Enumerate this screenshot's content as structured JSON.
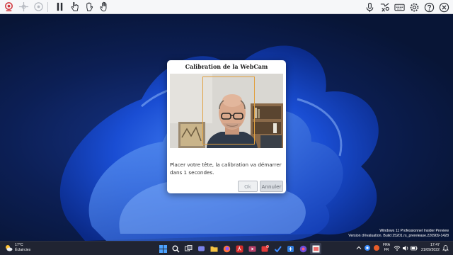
{
  "dialog": {
    "title": "Calibration de la WebCam",
    "message": "Placer votre tête, la calibration va démarrer dans 1 secondes.",
    "ok_label": "Ok",
    "cancel_label": "Annuler"
  },
  "watermark": {
    "line1": "Windows 11 Professionnel Insider Preview",
    "line2": "Version d'évaluation. Build 25201.rs_prerelease.220909-1428"
  },
  "weather": {
    "temp": "17°C",
    "condition": "Éclaircies"
  },
  "tray": {
    "lang_top": "FRA",
    "lang_bottom": "FR",
    "time": "17:47",
    "date": "21/09/2022"
  },
  "toolbar": {
    "left_icons": [
      "webcam-icon",
      "crosshair-icon",
      "gaze-icon",
      "pause-icon",
      "hand-pointer-icon",
      "hand-grab-icon",
      "hand-open-icon"
    ],
    "right_icons": [
      "microphone-icon",
      "accessibility-icon",
      "keyboard-icon",
      "gear-icon",
      "help-icon",
      "close-icon"
    ]
  },
  "colors": {
    "accent": "#1e5cff",
    "face_frame": "#e0a040",
    "taskbar": "#202432"
  }
}
